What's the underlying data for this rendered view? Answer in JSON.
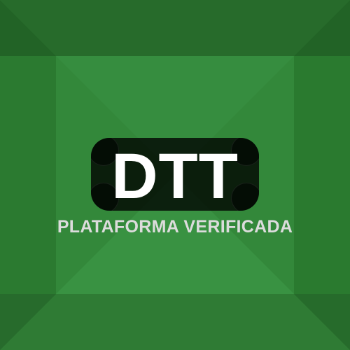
{
  "logo": {
    "text": "DTT"
  },
  "tagline": "PLATAFORMA VERIFICADA",
  "colors": {
    "background_base": "#2e7d32",
    "background_band_top": "#2a6e2e",
    "background_band_bottom": "#2f7a34",
    "background_side_left": "#2b7a30",
    "background_side_right": "#2b7a30",
    "center_light": "#3f9a48",
    "logo_box": "#0b0b0b",
    "logo_text": "#ffffff",
    "tagline_text": "#dcdcdc"
  }
}
